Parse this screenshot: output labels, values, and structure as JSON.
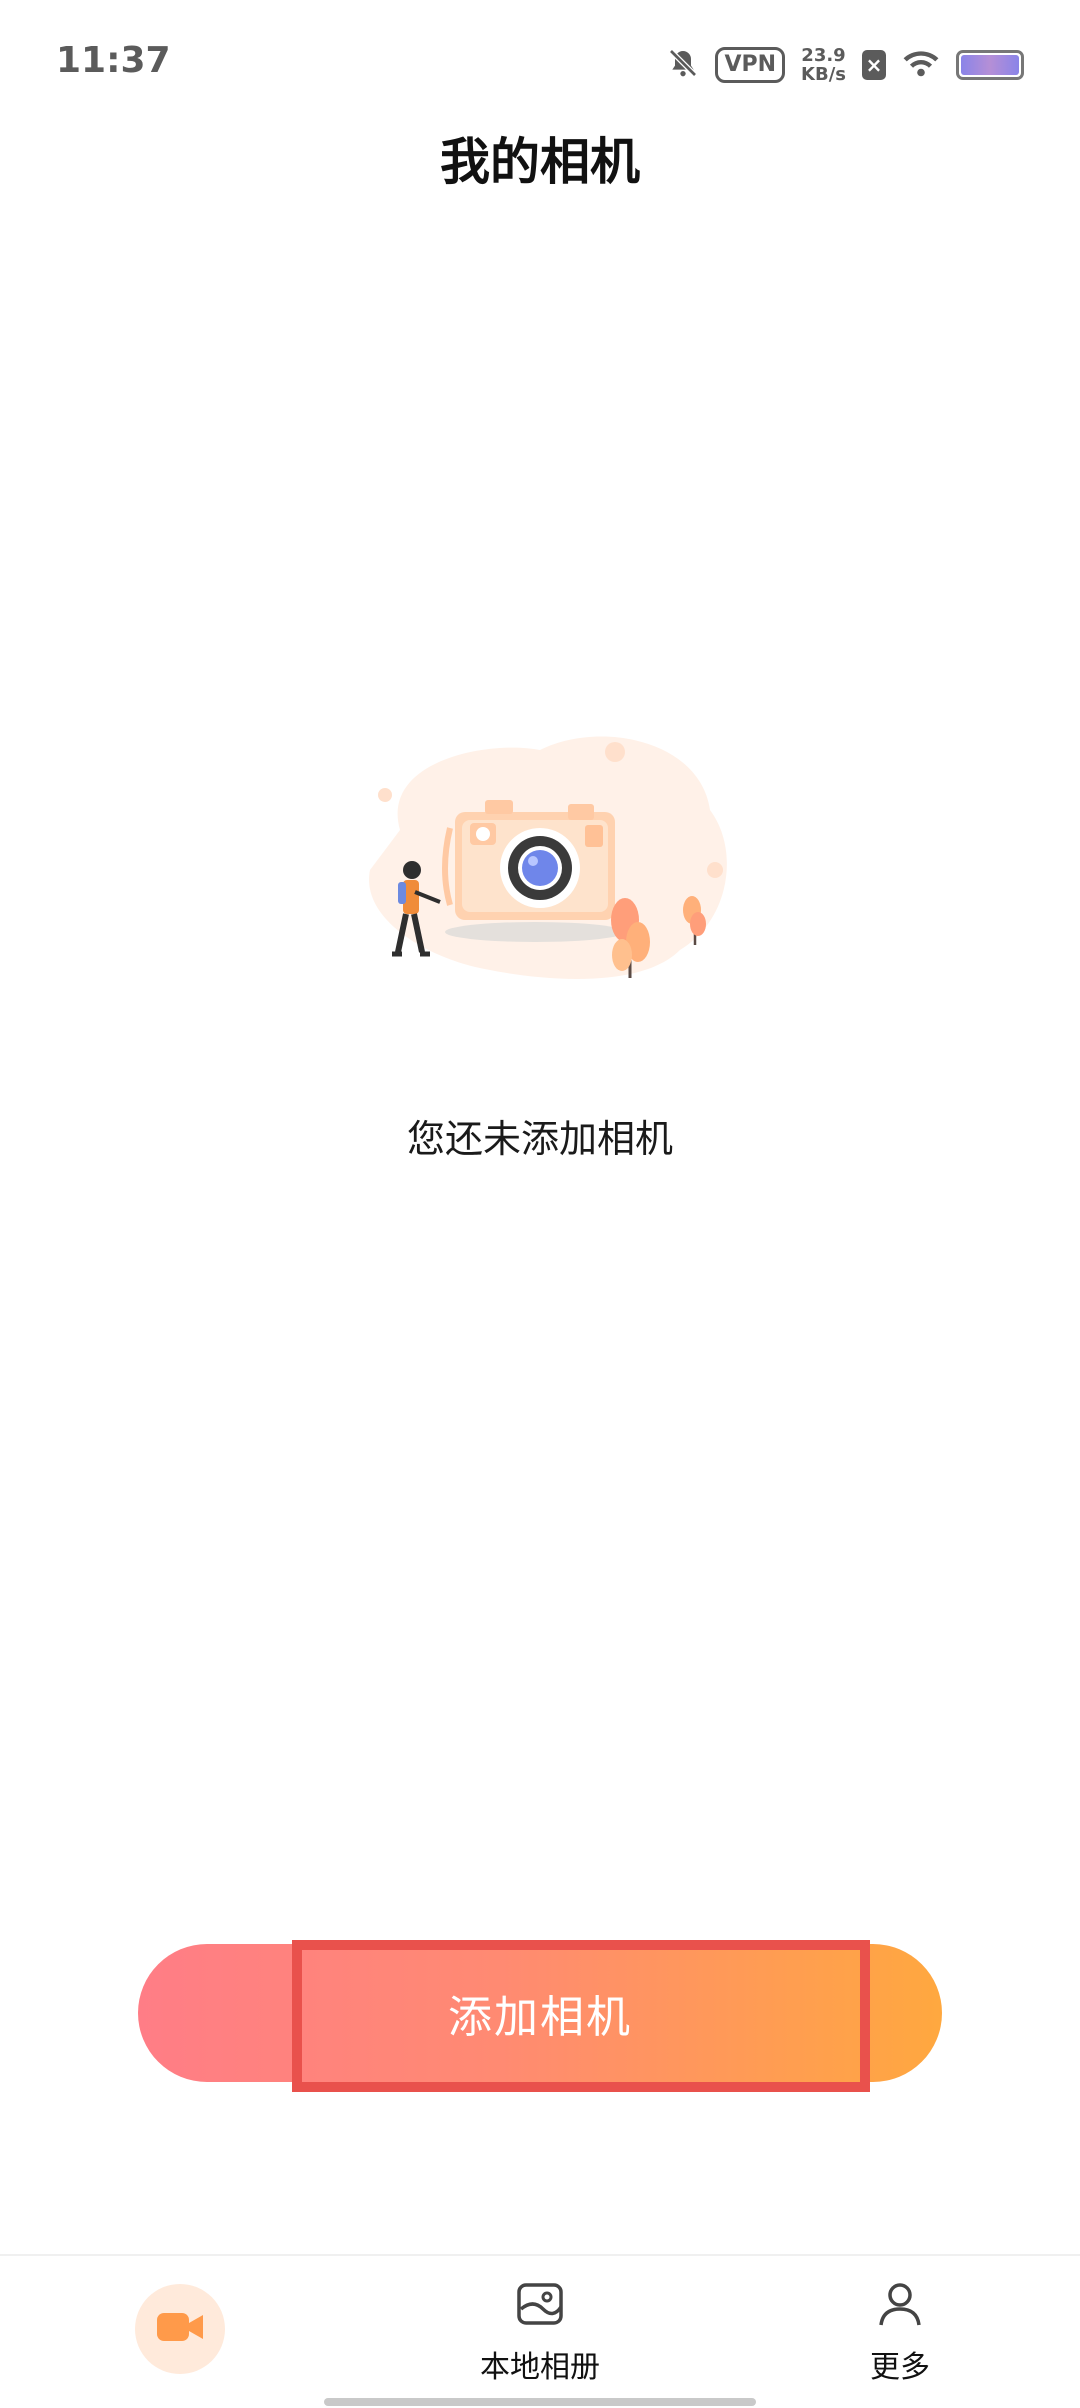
{
  "status_bar": {
    "time": "11:37",
    "vpn": "VPN",
    "speed_value": "23.9",
    "speed_unit": "KB/s",
    "icons": [
      "bell-muted-icon",
      "vpn-icon",
      "box-x-icon",
      "wifi-icon",
      "battery-icon"
    ]
  },
  "header": {
    "title": "我的相机"
  },
  "empty_state": {
    "illustration": "camera-illustration",
    "message": "您还未添加相机"
  },
  "add_button": {
    "label": "添加相机"
  },
  "bottom_nav": {
    "items": [
      {
        "label": "",
        "icon": "video-camera-icon",
        "active": true
      },
      {
        "label": "本地相册",
        "icon": "album-icon",
        "active": false
      },
      {
        "label": "更多",
        "icon": "person-icon",
        "active": false
      }
    ]
  },
  "colors": {
    "accent": "#ff9a4a",
    "button_gradient_start": "#ff7d86",
    "button_gradient_end": "#ffa83f",
    "highlight": "#e9514c"
  }
}
